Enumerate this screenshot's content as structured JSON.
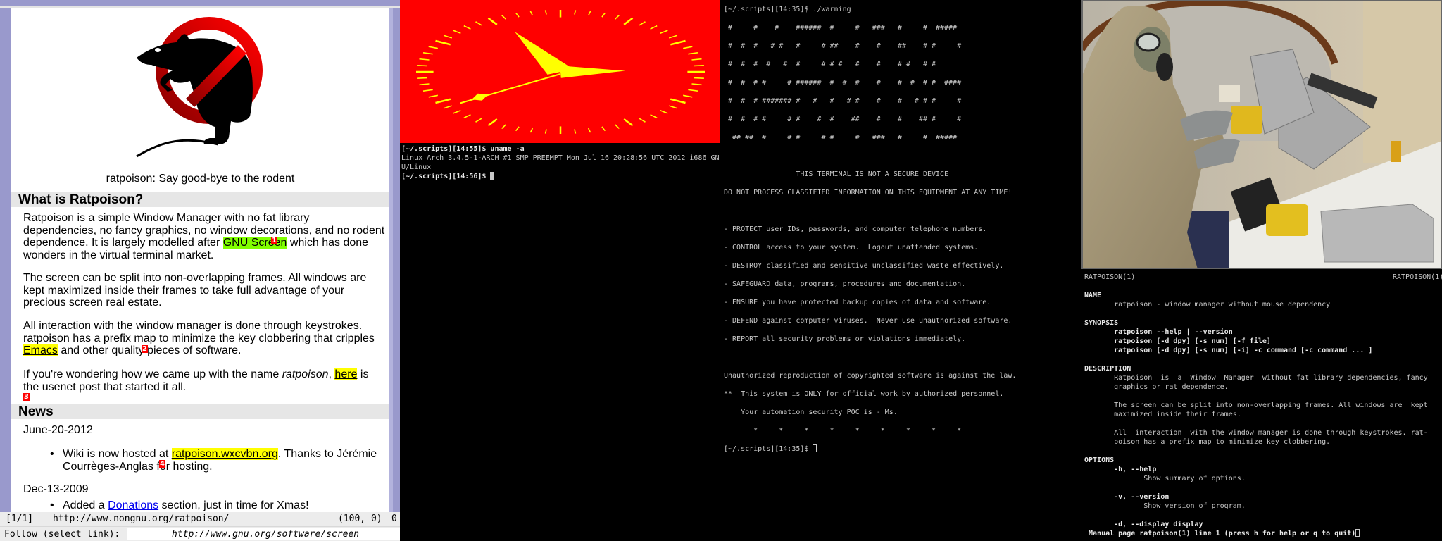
{
  "browser": {
    "logo_caption": "ratpoison: Say good-bye to the rodent",
    "logo_alt": "ratpoison no-rat logo",
    "sections": {
      "what_title": "What is Ratpoison?",
      "news_title": "News"
    },
    "paragraphs": [
      [
        [
          {
            "t": "Ratpoison is a simple Window Manager with no fat library"
          }
        ],
        [
          {
            "t": "dependencies, no fancy graphics, no window decorations, and no rodent"
          }
        ],
        [
          {
            "t": "dependence. It is largely modelled after "
          },
          {
            "t": "GNU Screen",
            "link": "focus"
          },
          {
            "t": " which has done"
          }
        ],
        [
          {
            "t": "wonders in the virtual terminal market."
          }
        ]
      ],
      [
        [
          {
            "t": "The screen can be split into non-overlapping frames. All windows are"
          }
        ],
        [
          {
            "t": "kept maximized inside their frames to take full advantage of your"
          }
        ],
        [
          {
            "t": "precious screen real estate."
          }
        ]
      ],
      [
        [
          {
            "t": "All interaction with the window manager is done through keystrokes."
          }
        ],
        [
          {
            "t": "ratpoison has a prefix map to minimize the key clobbering that cripples"
          }
        ],
        [
          {
            "t": "Emacs",
            "link": "hint"
          },
          {
            "t": " and other quality pieces of software."
          }
        ]
      ],
      [
        [
          {
            "t": "If you're wondering how we came up with the name "
          },
          {
            "t": "ratpoison",
            "em": true
          },
          {
            "t": ", "
          },
          {
            "t": "here",
            "link": "hint"
          },
          {
            "t": " is"
          }
        ],
        [
          {
            "t": "the usenet post that started it all."
          }
        ]
      ]
    ],
    "news": [
      {
        "date": "June-20-2012",
        "lines": [
          [
            {
              "t": "Wiki is now hosted at "
            },
            {
              "t": "ratpoison.wxcvbn.org",
              "link": "hint"
            },
            {
              "t": ". Thanks to Jérémie"
            }
          ],
          [
            {
              "t": "Courrèges-Anglas for hosting."
            }
          ]
        ]
      },
      {
        "date": "Dec-13-2009",
        "lines": [
          [
            {
              "t": "Added a "
            },
            {
              "t": "Donations",
              "link": "blue"
            },
            {
              "t": " section, just in time for Xmas!"
            }
          ]
        ]
      }
    ],
    "hints": [
      "1",
      "2",
      "3",
      "4"
    ],
    "status": {
      "count": "[1/1]",
      "url": "http://www.nongnu.org/ratpoison/",
      "scroll": "(100, 0)",
      "mode": "0"
    },
    "follow": {
      "label": "Follow (select link):",
      "value": "http://www.gnu.org/software/screen"
    }
  },
  "clock": {
    "hours": 14,
    "minutes": 55,
    "seconds": 39,
    "face_color": "#ff0000",
    "hand_color": "#ffff00"
  },
  "term_uname": {
    "lines": [
      "[~/.scripts][14:55]$ uname -a",
      "Linux Arch 3.4.5-1-ARCH #1 SMP PREEMPT Mon Jul 16 20:28:56 UTC 2012 i686 GN",
      "U/Linux",
      "[~/.scripts][14:56]$ "
    ]
  },
  "term_warning": {
    "lines": [
      "[~/.scripts][14:35]$ ./warning",
      "",
      " #     #    #    ######  #     #   ###   #     #  #####",
      "",
      " #  #  #   # #   #     # ##    #    #    ##    # #     #",
      "",
      " #  #  #  #   #  #     # # #   #    #    # #   # #",
      "",
      " #  #  # #     # ######  #  #  #    #    #  #  # #  ####",
      "",
      " #  #  # ####### #   #   #   # #    #    #   # # #     #",
      "",
      " #  #  # #     # #    #  #    ##    #    #    ## #     #",
      "",
      "  ## ##  #     # #     # #     #   ###   #     #  #####",
      "",
      "",
      "",
      "                 THIS TERMINAL IS NOT A SECURE DEVICE",
      "",
      "DO NOT PROCESS CLASSIFIED INFORMATION ON THIS EQUIPMENT AT ANY TIME!",
      "",
      "",
      "",
      "- PROTECT user IDs, passwords, and computer telephone numbers.",
      "",
      "- CONTROL access to your system.  Logout unattended systems.",
      "",
      "- DESTROY classified and sensitive unclassified waste effectively.",
      "",
      "- SAFEGUARD data, programs, procedures and documentation.",
      "",
      "- ENSURE you have protected backup copies of data and software.",
      "",
      "- DEFEND against computer viruses.  Never use unauthorized software.",
      "",
      "- REPORT all security problems or violations immediately.",
      "",
      "",
      "",
      "Unauthorized reproduction of copyrighted software is against the law.",
      "",
      "**  This system is ONLY for official work by authorized personnel.",
      "",
      "    Your automation security POC is - Ms.",
      "",
      "       *     *     *     *     *     *     *     *     *",
      "",
      "[~/.scripts][14:35]$ "
    ]
  },
  "photo": {
    "alt": "person in protective suit and gas mask operating equipment"
  },
  "manpage": {
    "header_left": "RATPOISON(1)",
    "header_right": "RATPOISON(1)",
    "lines": [
      {
        "t": ""
      },
      {
        "t": "NAME",
        "b": true
      },
      {
        "t": "       ratpoison - window manager without mouse dependency"
      },
      {
        "t": ""
      },
      {
        "t": "SYNOPSIS",
        "b": true
      },
      {
        "t": "       ratpoison --help | --version",
        "b": true
      },
      {
        "t": "       ratpoison [-d dpy] [-s num] [-f file]",
        "b": true
      },
      {
        "t": "       ratpoison [-d dpy] [-s num] [-i] -c command [-c command ... ]",
        "b": true
      },
      {
        "t": ""
      },
      {
        "t": "DESCRIPTION",
        "b": true
      },
      {
        "t": "       Ratpoison  is  a  Window  Manager  without fat library dependencies, fancy"
      },
      {
        "t": "       graphics or rat dependence."
      },
      {
        "t": ""
      },
      {
        "t": "       The screen can be split into non-overlapping frames. All windows are  kept"
      },
      {
        "t": "       maximized inside their frames."
      },
      {
        "t": ""
      },
      {
        "t": "       All  interaction  with the window manager is done through keystrokes. rat-"
      },
      {
        "t": "       poison has a prefix map to minimize key clobbering."
      },
      {
        "t": ""
      },
      {
        "t": "OPTIONS",
        "b": true
      },
      {
        "t": "       -h, --help",
        "b": true
      },
      {
        "t": "              Show summary of options."
      },
      {
        "t": ""
      },
      {
        "t": "       -v, --version",
        "b": true
      },
      {
        "t": "              Show version of program."
      },
      {
        "t": ""
      },
      {
        "t": "       -d, --display display",
        "b": true
      }
    ],
    "status": " Manual page ratpoison(1) line 1 (press h for help or q to quit)"
  }
}
